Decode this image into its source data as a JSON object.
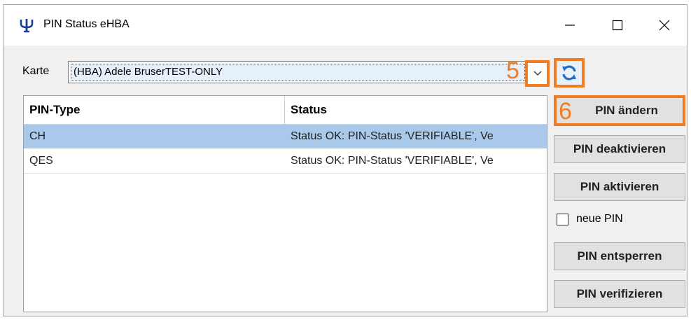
{
  "window": {
    "title": "PIN Status eHBA"
  },
  "card_selector": {
    "label": "Karte",
    "value": "(HBA) Adele BruserTEST-ONLY"
  },
  "annotations": {
    "step5": "5",
    "step6": "6"
  },
  "table": {
    "columns": [
      "PIN-Type",
      "Status"
    ],
    "rows": [
      {
        "type": "CH",
        "status": "Status OK: PIN-Status 'VERIFIABLE', Ve"
      },
      {
        "type": "QES",
        "status": "Status OK: PIN-Status 'VERIFIABLE', Ve"
      }
    ]
  },
  "actions": {
    "change_pin": "PIN ändern",
    "deactivate_pin": "PIN deaktivieren",
    "activate_pin": "PIN aktivieren",
    "new_pin_checkbox": "neue PIN",
    "unlock_pin": "PIN entsperren",
    "verify_pin": "PIN verifizieren"
  },
  "colors": {
    "highlight": "#f47c20",
    "selected_row": "#a9c9ea",
    "refresh_icon": "#1f6fc7"
  }
}
